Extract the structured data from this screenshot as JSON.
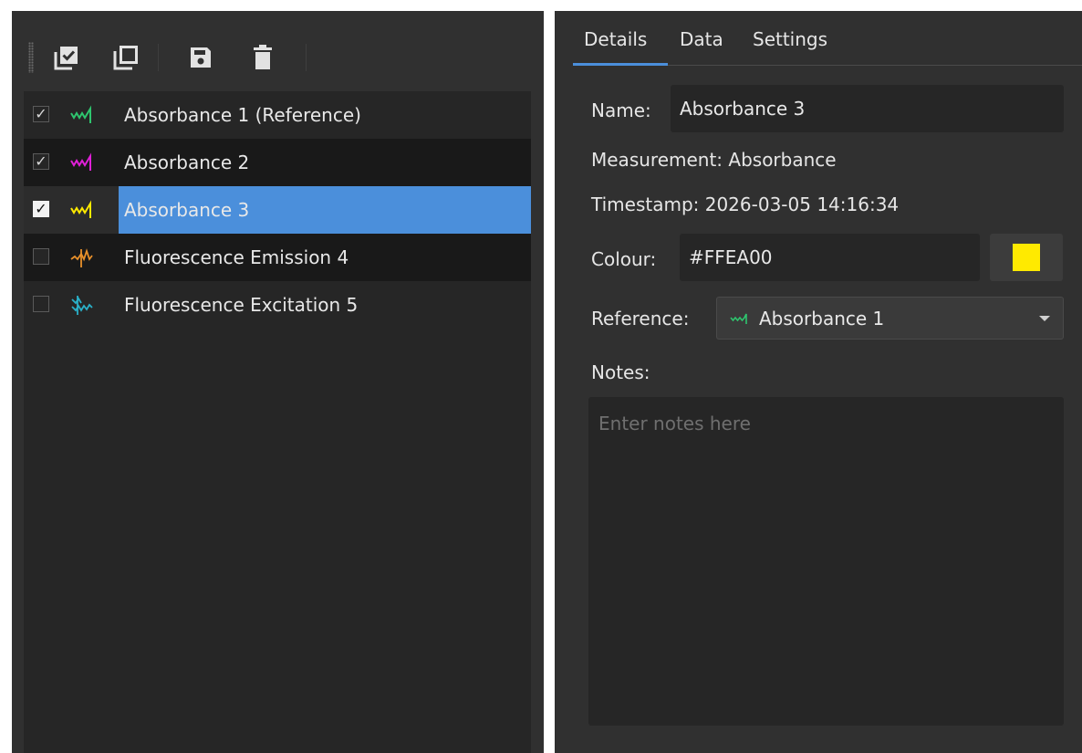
{
  "toolbar": {
    "buttons": [
      {
        "name": "check-all-button",
        "icon": "checkbox-checked-icon"
      },
      {
        "name": "duplicate-button",
        "icon": "copy-icon"
      },
      {
        "name": "save-button",
        "icon": "floppy-disk-icon"
      },
      {
        "name": "delete-button",
        "icon": "trash-icon"
      }
    ]
  },
  "measurements": [
    {
      "label": "Absorbance 1 (Reference)",
      "checked": true,
      "check_mark": "✓",
      "icon": "absorbance-wave-icon",
      "color": "#2ec56e"
    },
    {
      "label": "Absorbance 2",
      "checked": true,
      "check_mark": "✓",
      "icon": "absorbance-wave-icon",
      "color": "#e020d8"
    },
    {
      "label": "Absorbance 3",
      "checked": true,
      "check_mark": "✓",
      "icon": "absorbance-wave-icon",
      "color": "#ffea00",
      "selected": true
    },
    {
      "label": "Fluorescence Emission 4",
      "checked": false,
      "check_mark": "",
      "icon": "fluorescence-emission-icon",
      "color": "#e8902a"
    },
    {
      "label": "Fluorescence Excitation 5",
      "checked": false,
      "check_mark": "",
      "icon": "fluorescence-excitation-icon",
      "color": "#2ab0c8"
    }
  ],
  "tabs": [
    {
      "label": "Details",
      "active": true
    },
    {
      "label": "Data",
      "active": false
    },
    {
      "label": "Settings",
      "active": false
    }
  ],
  "details": {
    "name_label": "Name:",
    "name_value": "Absorbance 3",
    "measurement_text": "Measurement: Absorbance",
    "timestamp_text": "Timestamp: 2026-03-05 14:16:34",
    "colour_label": "Colour:",
    "colour_value": "#FFEA00",
    "swatch_color": "#ffea00",
    "reference_label": "Reference:",
    "reference_value": "Absorbance 1",
    "reference_icon_color": "#2ec56e",
    "notes_label": "Notes:",
    "notes_placeholder": "Enter notes here",
    "notes_value": ""
  }
}
